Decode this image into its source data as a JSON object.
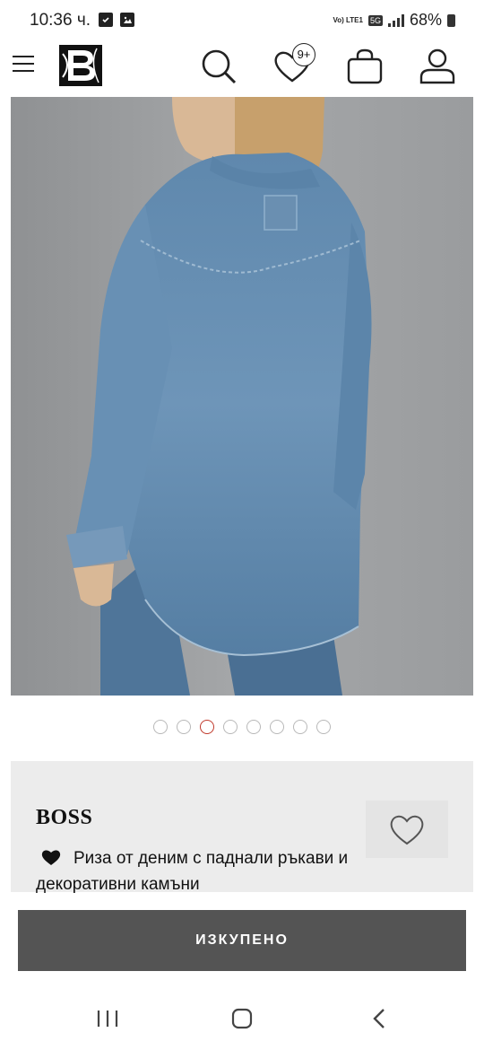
{
  "status_bar": {
    "time": "10:36 ч.",
    "network_tag": "Vo) LTE1",
    "network_5g": "5G",
    "battery": "68%"
  },
  "header": {
    "wishlist_count": "9+"
  },
  "gallery": {
    "image_alt": "Denim shirt back view",
    "dots_total": 8,
    "active_index": 2
  },
  "product": {
    "brand": "BOSS",
    "name": "Риза от деним с паднали ръкави и декоративни камъни"
  },
  "cta": {
    "label": "ИЗКУПЕНО"
  },
  "colors": {
    "accent_dot": "#c0392b",
    "cta_bg": "#545454",
    "panel_bg": "#ececec"
  }
}
